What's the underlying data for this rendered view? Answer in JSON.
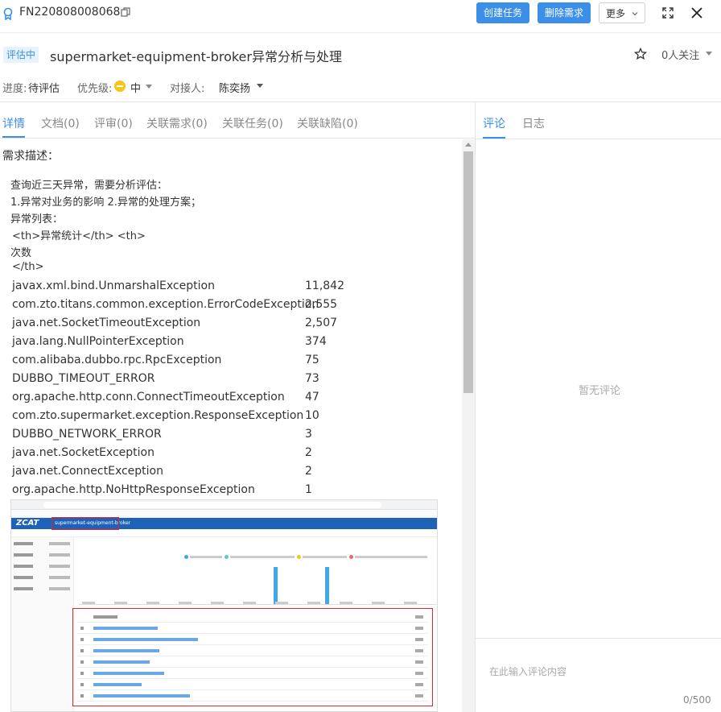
{
  "header": {
    "req_id": "FN220808008068",
    "buttons": {
      "create_task": "创建任务",
      "delete_req": "删除需求",
      "more": "更多"
    }
  },
  "title_row": {
    "status": "评估中",
    "title": "supermarket-equipment-broker异常分析与处理",
    "follow": "0人关注"
  },
  "meta": {
    "progress_label": "进度:",
    "progress_value": "待评估",
    "priority_label": "优先级:",
    "priority_value": "中",
    "contact_label": "对接人:",
    "contact_value": "陈奕扬"
  },
  "tabs_left": [
    "详情",
    "文档(0)",
    "评审(0)",
    "关联需求(0)",
    "关联任务(0)",
    "关联缺陷(0)"
  ],
  "detail": {
    "desc_label": "需求描述：",
    "lines": [
      "查询近三天异常，需要分析评估：",
      "1.异常对业务的影响 2.异常的处理方案；",
      "异常列表：",
      "<th>异常统计</th> <th>",
      "次数",
      "</th>"
    ],
    "exceptions": [
      {
        "name": "javax.xml.bind.UnmarshalException",
        "count": "11,842"
      },
      {
        "name": "com.zto.titans.common.exception.ErrorCodeException",
        "count": "2,555"
      },
      {
        "name": "java.net.SocketTimeoutException",
        "count": "2,507"
      },
      {
        "name": "java.lang.NullPointerException",
        "count": "374"
      },
      {
        "name": "com.alibaba.dubbo.rpc.RpcException",
        "count": "75"
      },
      {
        "name": "DUBBO_TIMEOUT_ERROR",
        "count": "73"
      },
      {
        "name": "org.apache.http.conn.ConnectTimeoutException",
        "count": "47"
      },
      {
        "name": "com.zto.supermarket.exception.ResponseException",
        "count": "10"
      },
      {
        "name": "DUBBO_NETWORK_ERROR",
        "count": "3"
      },
      {
        "name": "java.net.SocketException",
        "count": "2"
      },
      {
        "name": "java.net.ConnectException",
        "count": "2"
      },
      {
        "name": "org.apache.http.NoHttpResponseException",
        "count": "1"
      }
    ],
    "screenshot": {
      "logo": "ZCAT",
      "project": "supermarket-equipment-broker"
    }
  },
  "tabs_right": [
    "评论",
    "日志"
  ],
  "comments": {
    "empty": "暂无评论",
    "placeholder": "在此输入评论内容",
    "counter": "0/500"
  },
  "colors": {
    "accent": "#3b8fe8",
    "priority": "#f5c518",
    "highlight": "#e0262a"
  }
}
